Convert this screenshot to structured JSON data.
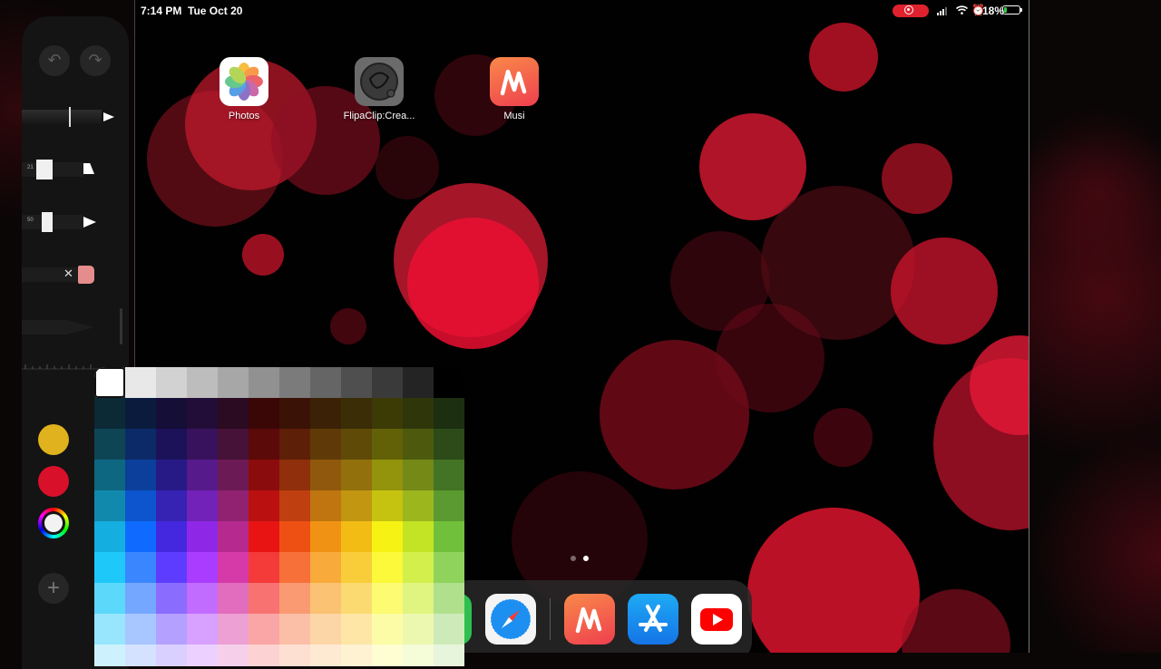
{
  "statusbar": {
    "time": "7:14 PM",
    "date": "Tue Oct 20",
    "battery": "18%"
  },
  "apps": [
    {
      "label": "Photos",
      "icon": "photos-icon"
    },
    {
      "label": "FlipaClip:Crea...",
      "icon": "flipaclip-icon"
    },
    {
      "label": "Musi",
      "icon": "musi-icon"
    }
  ],
  "dock": [
    {
      "icon": "facetime-icon"
    },
    {
      "icon": "safari-icon"
    },
    {
      "icon": "musi-icon"
    },
    {
      "icon": "app-store-icon"
    },
    {
      "icon": "youtube-icon"
    }
  ],
  "toolbar": {
    "undo_icon": "undo-icon",
    "redo_icon": "redo-icon",
    "marker_size_1": "21",
    "marker_size_2": "50",
    "add_icon": "plus-icon"
  },
  "colors": {
    "accent_red": "#e0222e",
    "swatch_yellow": "#e0b21e",
    "swatch_red": "#d8102a",
    "swatch_selected": "#f2f2f2"
  }
}
